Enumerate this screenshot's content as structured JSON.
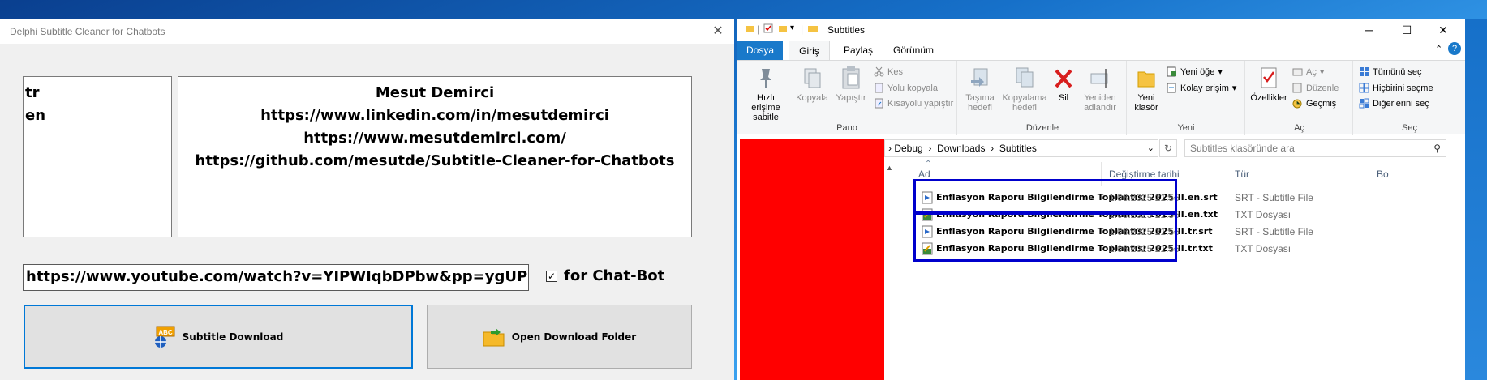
{
  "app": {
    "title": "Delphi Subtitle Cleaner for Chatbots",
    "languages": [
      "tr",
      "en"
    ],
    "info_lines": [
      "Mesut Demirci",
      "https://www.linkedin.com/in/mesutdemirci",
      "https://www.mesutdemirci.com/",
      "https://github.com/mesutde/Subtitle-Cleaner-for-Chatbots"
    ],
    "url_value": "https://www.youtube.com/watch?v=YIPWIqbDPbw&pp=ygUPbW",
    "checkbox_label": "for Chat-Bot",
    "checkbox_checked": true,
    "download_button": "Subtitle Download",
    "open_folder_button": "Open Download Folder"
  },
  "explorer": {
    "title": "Subtitles",
    "tabs": [
      "Dosya",
      "Giriş",
      "Paylaş",
      "Görünüm"
    ],
    "ribbon": {
      "pano": {
        "label": "Pano",
        "pin": "Hızlı erişime sabitle",
        "copy": "Kopyala",
        "paste": "Yapıştır",
        "cut": "Kes",
        "copy_path": "Yolu kopyala",
        "paste_shortcut": "Kısayolu yapıştır"
      },
      "duzenle": {
        "label": "Düzenle",
        "move": "Taşıma hedefi",
        "copyto": "Kopyalama hedefi",
        "delete": "Sil",
        "rename": "Yeniden adlandır"
      },
      "yeni": {
        "label": "Yeni",
        "new_folder": "Yeni klasör",
        "new_item": "Yeni öğe",
        "easy_access": "Kolay erişim"
      },
      "ac": {
        "label": "Aç",
        "properties": "Özellikler",
        "open": "Aç",
        "edit": "Düzenle",
        "history": "Geçmiş"
      },
      "sec": {
        "label": "Seç",
        "select_all": "Tümünü seç",
        "select_none": "Hiçbirini seçme",
        "invert": "Diğerlerini seç"
      }
    },
    "breadcrumb": [
      "Debug",
      "Downloads",
      "Subtitles"
    ],
    "search_placeholder": "Subtitles klasöründe ara",
    "columns": [
      "Ad",
      "Değiştirme tarihi",
      "Tür",
      "Bo"
    ],
    "files": [
      {
        "name": "Enflasyon Raporu Bilgilendirme Toplantısı 2025-II.en.srt",
        "date": "1.06.2025 21:55",
        "type": "SRT - Subtitle File"
      },
      {
        "name": "Enflasyon Raporu Bilgilendirme Toplantısı 2025-II.en.txt",
        "date": "1.06.2025 21:55",
        "type": "TXT Dosyası"
      },
      {
        "name": "Enflasyon Raporu Bilgilendirme Toplantısı 2025-II.tr.srt",
        "date": "1.06.2025 21:55",
        "type": "SRT - Subtitle File"
      },
      {
        "name": "Enflasyon Raporu Bilgilendirme Toplantısı 2025-II.tr.txt",
        "date": "1.06.2025 21:55",
        "type": "TXT Dosyası"
      }
    ]
  },
  "colors": {
    "highlight_border": "#0000cc",
    "redaction": "#ff0000",
    "file_tab": "#1979ca"
  }
}
